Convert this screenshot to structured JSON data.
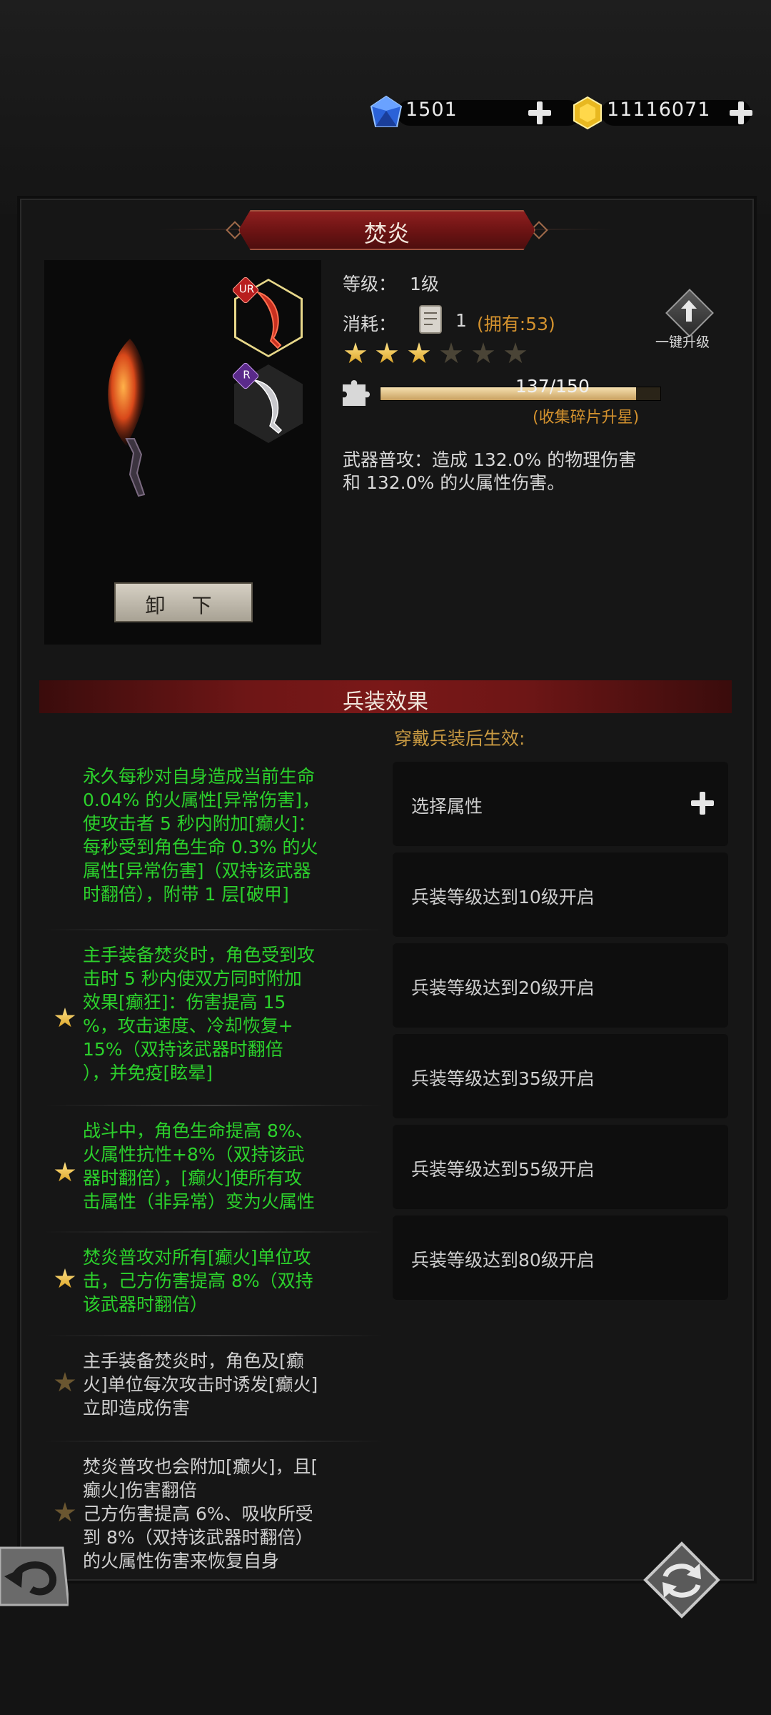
{
  "currency": {
    "gems": "1501",
    "gold": "11116071"
  },
  "title": "焚炎",
  "weapon": {
    "slots": [
      {
        "rarity": "UR"
      },
      {
        "rarity": "R"
      }
    ],
    "unequip_label": "卸 下"
  },
  "info": {
    "level_label": "等级：",
    "level_value": "1级",
    "cost_label": "消耗：",
    "cost_count": "1",
    "cost_owned": "(拥有:53)",
    "stars_total": 6,
    "stars_filled": 3,
    "fragments_text": "137/150",
    "fragments_current": 137,
    "fragments_max": 150,
    "fragments_hint": "(收集碎片升星)",
    "upgrade_label": "一键升级",
    "description_line1": "武器普攻：造成 132.0% 的物理伤害",
    "description_line2": "和 132.0% 的火属性伤害。"
  },
  "effects": {
    "banner": "兵装效果",
    "items": [
      {
        "star": "none",
        "style": "green",
        "lines": [
          "永久每秒对自身造成当前生命",
          "0.04% 的火属性[异常伤害]，",
          "使攻击者 5 秒内附加[癫火]：",
          "每秒受到角色生命 0.3% 的火",
          "属性[异常伤害]（双持该武器",
          "时翻倍），附带 1 层[破甲]"
        ]
      },
      {
        "star": "on",
        "style": "green",
        "lines": [
          "主手装备焚炎时，角色受到攻",
          "击时 5 秒内使双方同时附加",
          "效果[癫狂]：伤害提高 15",
          "%，攻击速度、冷却恢复+",
          "15%（双持该武器时翻倍",
          "），并免疫[眩晕]"
        ]
      },
      {
        "star": "on",
        "style": "green",
        "lines": [
          "战斗中，角色生命提高 8%、",
          "火属性抗性+8%（双持该武",
          "器时翻倍），[癫火]使所有攻",
          "击属性（非异常）变为火属性"
        ]
      },
      {
        "star": "on",
        "style": "green",
        "lines": [
          "焚炎普攻对所有[癫火]单位攻",
          "击，己方伤害提高 8%（双持",
          "该武器时翻倍）"
        ]
      },
      {
        "star": "dim",
        "style": "gray",
        "lines": [
          "主手装备焚炎时，角色及[癫",
          "火]单位每次攻击时诱发[癫火]",
          "立即造成伤害"
        ]
      },
      {
        "star": "dim",
        "style": "gray",
        "lines": [
          "焚炎普攻也会附加[癫火]，且[",
          "癫火]伤害翻倍",
          "己方伤害提高 6%、吸收所受",
          "到 8%（双持该武器时翻倍）",
          "的火属性伤害来恢复自身"
        ]
      }
    ]
  },
  "slots": {
    "title": "穿戴兵装后生效:",
    "items": [
      "选择属性",
      "兵装等级达到10级开启",
      "兵装等级达到20级开启",
      "兵装等级达到35级开启",
      "兵装等级达到55级开启",
      "兵装等级达到80级开启"
    ]
  },
  "colors": {
    "accent_red": "#7a1818",
    "text_green": "#2cd12c",
    "text_orange": "#d4922e",
    "star_gold": "#e8b830"
  }
}
